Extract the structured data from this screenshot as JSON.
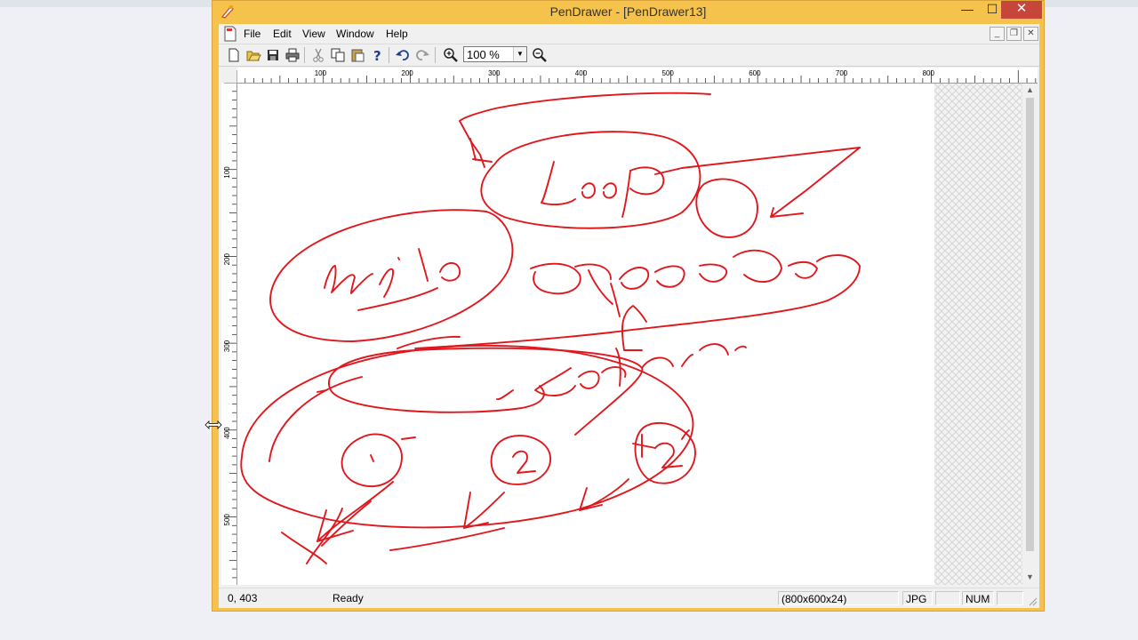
{
  "window": {
    "title": "PenDrawer - [PenDrawer13]",
    "controls": {
      "minimize": "—",
      "maximize": "☐",
      "close": "✕"
    }
  },
  "menu": [
    "File",
    "Edit",
    "View",
    "Window",
    "Help"
  ],
  "toolbar": {
    "buttons": [
      "new-icon",
      "open-icon",
      "save-icon",
      "print-icon",
      "cut-icon",
      "copy-icon",
      "paste-icon",
      "help-icon",
      "undo-icon",
      "redo-icon",
      "zoom-in-icon",
      "zoom-out-icon"
    ],
    "zoom_value": "100 %"
  },
  "rulers": {
    "horizontal_ticks": [
      "100",
      "200",
      "300",
      "400",
      "500",
      "600",
      "700",
      "800"
    ],
    "vertical_ticks": [
      "100",
      "200",
      "300",
      "400",
      "500"
    ]
  },
  "status": {
    "coords": "0, 403",
    "message": "Ready",
    "image_info": "(800x600x24)",
    "format": "JPG",
    "num": "NUM"
  },
  "canvas": {
    "stroke_color": "#e0181e",
    "background": "#ffffff"
  }
}
